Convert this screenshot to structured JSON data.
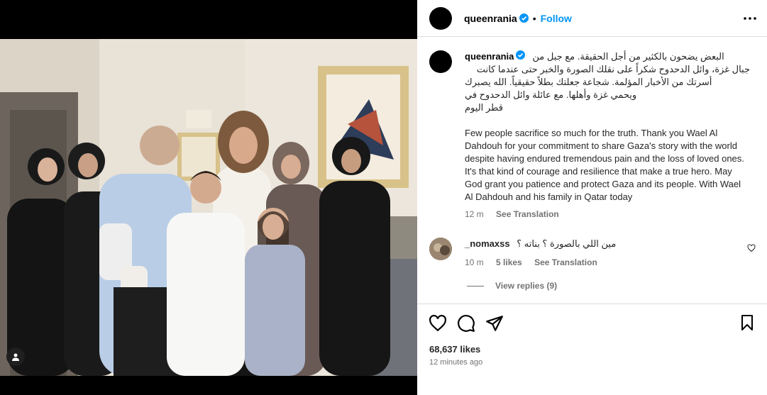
{
  "post": {
    "username": "queenrania",
    "follow_label": "Follow",
    "dot": "•"
  },
  "caption": {
    "username": "queenrania",
    "arabic": [
      "البعض يضحون بالكثير من أجل الحقيقة. مع جبل من",
      "جبال غزة، وائل الدحدوح شكراً على نقلك الصورة والخبر حتى عندما كانت",
      "أسرتك من الأخبار المؤلمة. شجاعة جعلتك بطلاً حقيقياً. الله يصبرك",
      "ويحمي غزة وأهلها. مع عائلة وائل الدحدوح في",
      "قطر اليوم"
    ],
    "english": "Few people sacrifice so much for the truth. Thank you Wael Al Dahdouh for your commitment to share Gaza's story with the world despite having endured tremendous pain and the loss of loved ones. It's that kind of courage and resilience that make a true hero. May God grant you patience and protect Gaza and its people. With Wael Al Dahdouh and his family in Qatar today",
    "time": "12 m",
    "see_translation": "See Translation"
  },
  "comment": {
    "username": "_nomaxss",
    "text": "مين اللي بالصورة ؟ بناته ؟",
    "time": "10 m",
    "likes": "5 likes",
    "see_translation": "See Translation",
    "view_replies": "View replies (9)"
  },
  "footer": {
    "likes": "68,637 likes",
    "time_ago": "12 minutes ago"
  },
  "icons": {
    "more": "more-options-icon",
    "verified": "verified-badge-icon",
    "like": "heart-icon",
    "comment": "comment-bubble-icon",
    "share": "paper-plane-icon",
    "save": "bookmark-icon",
    "tag": "user-tag-icon"
  },
  "colors": {
    "accent": "#0095f6",
    "verified": "#0095f6",
    "secondary_text": "#737373",
    "divider": "#dbdbdb"
  }
}
